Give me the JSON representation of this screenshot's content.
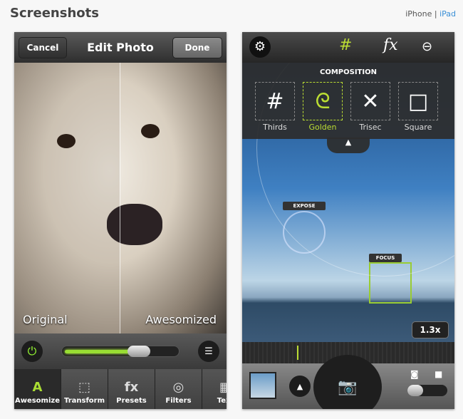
{
  "header": {
    "title": "Screenshots",
    "device_iphone": "iPhone",
    "separator": "|",
    "device_ipad": "iPad"
  },
  "edit": {
    "cancel": "Cancel",
    "title": "Edit Photo",
    "done": "Done",
    "label_original": "Original",
    "label_awesomized": "Awesomized",
    "slider_value": 0.65,
    "tabs": [
      {
        "icon": "awesomize-icon",
        "glyph": "A",
        "label": "Awesomize"
      },
      {
        "icon": "transform-icon",
        "glyph": "⬚",
        "label": "Transform"
      },
      {
        "icon": "presets-fx-icon",
        "glyph": "fx",
        "label": "Presets"
      },
      {
        "icon": "filters-icon",
        "glyph": "◎",
        "label": "Filters"
      },
      {
        "icon": "texture-icon",
        "glyph": "▦",
        "label": "Text"
      }
    ]
  },
  "camera": {
    "composition_title": "COMPOSITION",
    "options": [
      {
        "label": "Thirds",
        "glyph": "#"
      },
      {
        "label": "Golden",
        "glyph": "ᘓ"
      },
      {
        "label": "Trisec",
        "glyph": "✕"
      },
      {
        "label": "Square",
        "glyph": "□"
      }
    ],
    "expose": "EXPOSE",
    "focus": "FOCUS",
    "zoom": "1.3x"
  },
  "colors": {
    "accent": "#aadd33",
    "link": "#3a8fd6"
  }
}
